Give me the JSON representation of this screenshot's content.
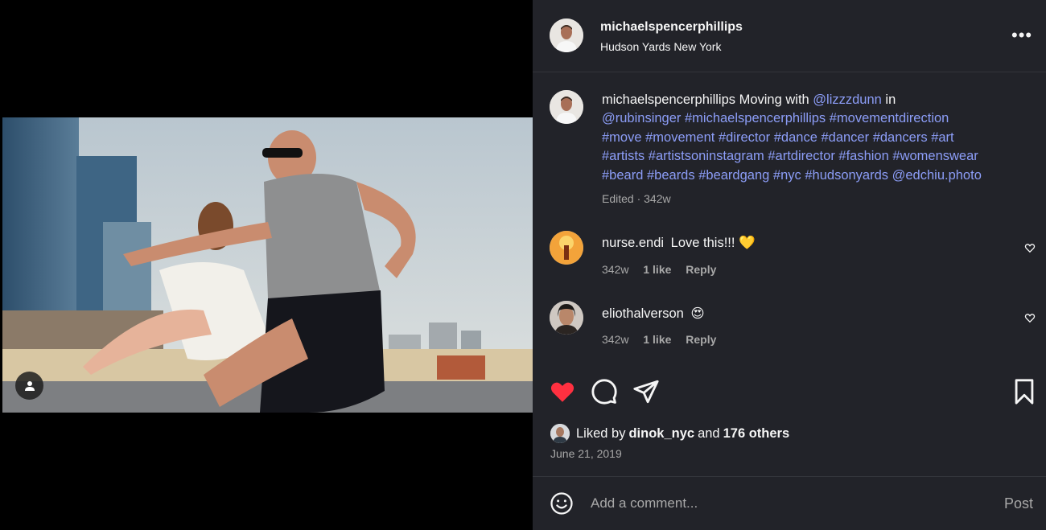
{
  "post": {
    "username": "michaelspencerphillips",
    "location": "Hudson Yards New York",
    "more_icon": "more-options-icon"
  },
  "caption": {
    "username": "michaelspencerphillips",
    "text_before": " Moving with ",
    "mention1": "@lizzzdunn",
    "text_in": " in",
    "mention2": "@rubinsinger",
    "hashtags_line1": [
      "#michaelspencerphillips",
      "#movementdirection"
    ],
    "hashtags_line2": [
      "#move",
      "#movement",
      "#director",
      "#dance",
      "#dancer",
      "#dancers",
      "#art"
    ],
    "hashtags_line3": [
      "#artists",
      "#artistsoninstagram",
      "#artdirector",
      "#fashion",
      "#womenswear"
    ],
    "hashtags_line4": [
      "#beard",
      "#beards",
      "#beardgang",
      "#nyc",
      "#hudsonyards"
    ],
    "mention3": "@edchiu.photo",
    "meta": "Edited · 342w"
  },
  "comments": [
    {
      "username": "nurse.endi",
      "text": "Love this!!! 💛",
      "age": "342w",
      "likes": "1 like",
      "reply": "Reply"
    },
    {
      "username": "eliothalverson",
      "text": "😍",
      "age": "342w",
      "likes": "1 like",
      "reply": "Reply"
    }
  ],
  "likes": {
    "prefix": "Liked by",
    "user": "dinok_nyc",
    "and": "and",
    "others": "176 others"
  },
  "date": "June 21, 2019",
  "comment_box": {
    "placeholder": "Add a comment...",
    "post_label": "Post"
  },
  "colors": {
    "like_red": "#ff3040",
    "link_blue": "#8c9df7",
    "panel_bg": "#222329"
  }
}
